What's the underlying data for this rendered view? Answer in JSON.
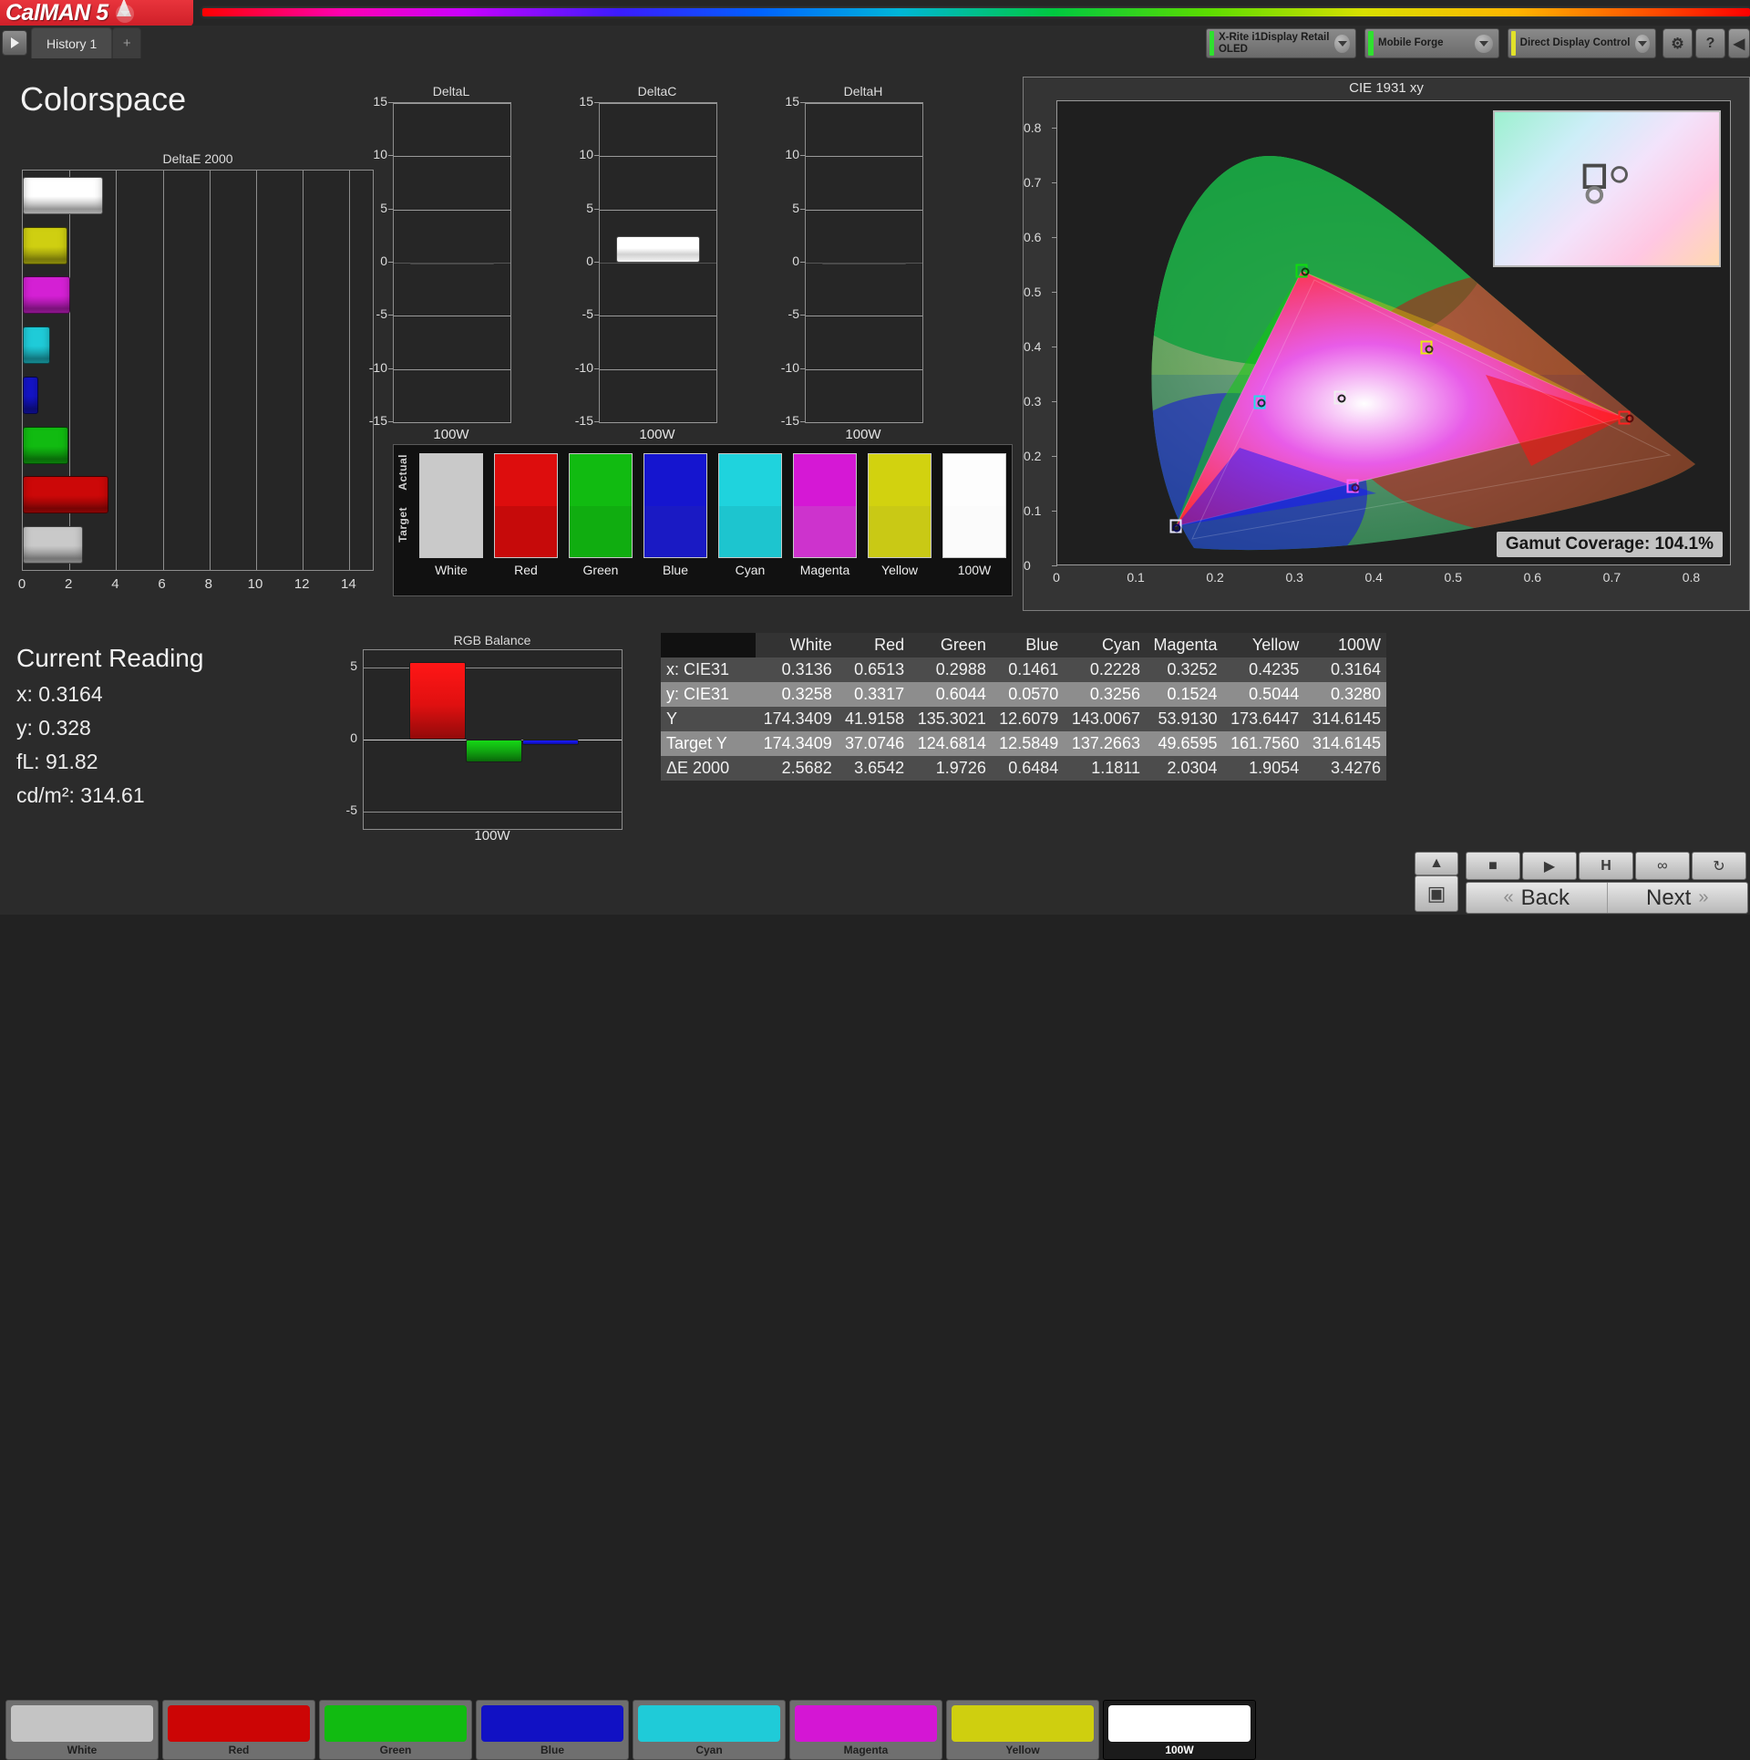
{
  "app": {
    "logo_text": "CalMAN 5",
    "dropdown_caret_icon": "chevron-down-icon"
  },
  "toolbar": {
    "play_icon": "play-icon",
    "tabs": [
      {
        "label": "History 1"
      }
    ],
    "add_tab_label": "+",
    "meter": {
      "line1": "X-Rite i1Display Retail",
      "line2": "OLED",
      "status_color": "#2fe02f"
    },
    "source": {
      "line1": "Mobile Forge",
      "line2": "",
      "status_color": "#2fe02f"
    },
    "display": {
      "line1": "Direct Display Control",
      "line2": "",
      "status_color": "#e2e22a"
    },
    "settings_icon": "gear-icon",
    "help_icon": "help-icon",
    "collapse_icon": "chevron-left-icon"
  },
  "page_title": "Colorspace",
  "current_reading": {
    "heading": "Current Reading",
    "x_label": "x: 0.3164",
    "y_label": "y: 0.328",
    "fl_label": "fL: 91.82",
    "cdm2_label": "cd/m²: 314.61"
  },
  "gamut": {
    "badge": "Gamut Coverage:  104.1%"
  },
  "colors": {
    "white": "#c9c9c9",
    "red": "#cc0808",
    "green": "#11bb11",
    "blue": "#1414c8",
    "cyan": "#1fcbd8",
    "magenta": "#d420d4",
    "yellow": "#cfcf11",
    "w100": "#ffffff"
  },
  "chart_data": [
    {
      "type": "bar",
      "title": "DeltaE 2000",
      "orientation": "horizontal",
      "categories": [
        "100W",
        "Yellow",
        "Magenta",
        "Cyan",
        "Blue",
        "Green",
        "Red",
        "White"
      ],
      "values": [
        3.4276,
        1.9054,
        2.0304,
        1.1811,
        0.6484,
        1.9726,
        3.6542,
        2.5682
      ],
      "bar_colors": [
        "#ffffff",
        "#cfcf11",
        "#d420d4",
        "#1fcbd8",
        "#1414c8",
        "#11bb11",
        "#cc0808",
        "#c9c9c9"
      ],
      "xlabel": "",
      "ylabel": "",
      "xlim": [
        0,
        15
      ],
      "xticks": [
        0,
        2,
        4,
        6,
        8,
        10,
        12,
        14
      ],
      "grid": true
    },
    {
      "type": "bar",
      "title": "DeltaL",
      "categories": [
        "100W"
      ],
      "values": [
        0.0
      ],
      "ylim": [
        -15,
        15
      ],
      "yticks": [
        15,
        10,
        5,
        0,
        -5,
        -10,
        -15
      ],
      "xlabel": "100W",
      "ylabel": "",
      "grid": true
    },
    {
      "type": "bar",
      "title": "DeltaC",
      "categories": [
        "100W"
      ],
      "values": [
        2.5
      ],
      "ylim": [
        -15,
        15
      ],
      "yticks": [
        15,
        10,
        5,
        0,
        -5,
        -10,
        -15
      ],
      "xlabel": "100W",
      "ylabel": "",
      "grid": true
    },
    {
      "type": "bar",
      "title": "DeltaH",
      "categories": [
        "100W"
      ],
      "values": [
        0.0
      ],
      "ylim": [
        -15,
        15
      ],
      "yticks": [
        15,
        10,
        5,
        0,
        -5,
        -10,
        -15
      ],
      "xlabel": "100W",
      "ylabel": "",
      "grid": true
    },
    {
      "type": "bar",
      "title": "RGB Balance",
      "categories": [
        "Red",
        "Green",
        "Blue"
      ],
      "values": [
        5.4,
        -1.6,
        -0.35
      ],
      "series_colors": [
        "#e01010",
        "#10a010",
        "#1414dd"
      ],
      "ylim": [
        -6.2,
        6.2
      ],
      "yticks": [
        5,
        0,
        -5
      ],
      "xlabel": "100W",
      "ylabel": "",
      "grid": true
    },
    {
      "type": "scatter",
      "title": "CIE 1931 xy",
      "xlabel": "",
      "ylabel": "",
      "xlim": [
        0,
        0.85
      ],
      "ylim": [
        0,
        0.85
      ],
      "xticks": [
        0,
        0.1,
        0.2,
        0.3,
        0.4,
        0.5,
        0.6,
        0.7,
        0.8
      ],
      "yticks": [
        0,
        0.1,
        0.2,
        0.3,
        0.4,
        0.5,
        0.6,
        0.7,
        0.8
      ],
      "points": [
        {
          "name": "Red",
          "x": 0.6513,
          "y": 0.3317
        },
        {
          "name": "Green",
          "x": 0.2988,
          "y": 0.6044
        },
        {
          "name": "Blue",
          "x": 0.1461,
          "y": 0.057
        },
        {
          "name": "Cyan",
          "x": 0.2228,
          "y": 0.3256
        },
        {
          "name": "Magenta",
          "x": 0.3252,
          "y": 0.1524
        },
        {
          "name": "Yellow",
          "x": 0.4235,
          "y": 0.5044
        },
        {
          "name": "White",
          "x": 0.3136,
          "y": 0.3258
        }
      ],
      "annotation": "Gamut Coverage:  104.1%"
    }
  ],
  "delta_panels": [
    {
      "title": "DeltaL",
      "caption": "100W"
    },
    {
      "title": "DeltaC",
      "caption": "100W"
    },
    {
      "title": "DeltaH",
      "caption": "100W"
    }
  ],
  "delta_ticks": [
    "15",
    "10",
    "5",
    "0",
    "-5",
    "-10",
    "-15"
  ],
  "deltae": {
    "title": "DeltaE 2000",
    "xticks": [
      "0",
      "2",
      "4",
      "6",
      "8",
      "10",
      "12",
      "14"
    ]
  },
  "swatch_panel": {
    "actual_label": "Actual",
    "target_label": "Target",
    "columns": [
      {
        "label": "White",
        "actual": "#c9c9c9",
        "target": "#c9c9c9"
      },
      {
        "label": "Red",
        "actual": "#dd0d0d",
        "target": "#c60a0a"
      },
      {
        "label": "Green",
        "actual": "#11bb11",
        "target": "#10ad10"
      },
      {
        "label": "Blue",
        "actual": "#1515cf",
        "target": "#1a1ac4"
      },
      {
        "label": "Cyan",
        "actual": "#1fd3dd",
        "target": "#1dc5cf"
      },
      {
        "label": "Magenta",
        "actual": "#d518d5",
        "target": "#cd33cd"
      },
      {
        "label": "Yellow",
        "actual": "#d2d20f",
        "target": "#c9c915"
      },
      {
        "label": "100W",
        "actual": "#fdfdfd",
        "target": "#fbfbfb"
      }
    ]
  },
  "table": {
    "columns": [
      "",
      "White",
      "Red",
      "Green",
      "Blue",
      "Cyan",
      "Magenta",
      "Yellow",
      "100W"
    ],
    "rows": [
      {
        "label": "x: CIE31",
        "cells": [
          "0.3136",
          "0.6513",
          "0.2988",
          "0.1461",
          "0.2228",
          "0.3252",
          "0.4235",
          "0.3164"
        ]
      },
      {
        "label": "y: CIE31",
        "cells": [
          "0.3258",
          "0.3317",
          "0.6044",
          "0.0570",
          "0.3256",
          "0.1524",
          "0.5044",
          "0.3280"
        ]
      },
      {
        "label": "Y",
        "cells": [
          "174.3409",
          "41.9158",
          "135.3021",
          "12.6079",
          "143.0067",
          "53.9130",
          "173.6447",
          "314.6145"
        ]
      },
      {
        "label": "Target Y",
        "cells": [
          "174.3409",
          "37.0746",
          "124.6814",
          "12.5849",
          "137.2663",
          "49.6595",
          "161.7560",
          "314.6145"
        ]
      },
      {
        "label": "ΔE 2000",
        "cells": [
          "2.5682",
          "3.6542",
          "1.9726",
          "0.6484",
          "1.1811",
          "2.0304",
          "1.9054",
          "3.4276"
        ]
      }
    ]
  },
  "bottom_buttons": [
    {
      "label": "White",
      "color": "#c4c4c4",
      "selected": false
    },
    {
      "label": "Red",
      "color": "#cc0505",
      "selected": false
    },
    {
      "label": "Green",
      "color": "#11bb11",
      "selected": false
    },
    {
      "label": "Blue",
      "color": "#1111c4",
      "selected": false
    },
    {
      "label": "Cyan",
      "color": "#1fcbd8",
      "selected": false
    },
    {
      "label": "Magenta",
      "color": "#d416d4",
      "selected": false
    },
    {
      "label": "Yellow",
      "color": "#cfcf0f",
      "selected": false
    },
    {
      "label": "100W",
      "color": "#ffffff",
      "selected": true
    }
  ],
  "transport": {
    "up_icon": "chevron-up-icon",
    "target_icon": "target-icon",
    "stop_icon": "stop-icon",
    "play_icon": "play-icon",
    "half_icon": "half-field-icon",
    "loop_icon": "infinity-icon",
    "refresh_icon": "refresh-icon",
    "back_label": "Back",
    "next_label": "Next",
    "back_icon": "double-chevron-left-icon",
    "next_icon": "double-chevron-right-icon"
  }
}
